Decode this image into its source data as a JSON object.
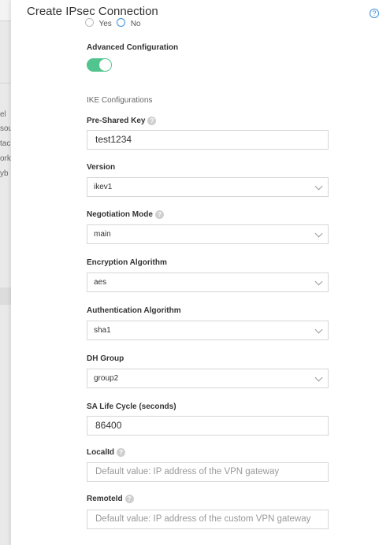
{
  "backdrop": {
    "lines": [
      "el",
      "sou",
      "tac",
      "ork",
      "yb"
    ]
  },
  "drawer": {
    "title": "Create IPsec Connection",
    "help_icon": "?"
  },
  "radio_group": {
    "options": [
      {
        "label": "Yes",
        "checked": false
      },
      {
        "label": "No",
        "checked": true
      }
    ]
  },
  "advanced": {
    "label": "Advanced Configuration",
    "enabled": true
  },
  "ike_section": "IKE Configurations",
  "fields": {
    "psk": {
      "label": "Pre-Shared Key",
      "value": "test1234"
    },
    "version": {
      "label": "Version",
      "value": "ikev1"
    },
    "negotiation": {
      "label": "Negotiation Mode",
      "value": "main"
    },
    "encryption": {
      "label": "Encryption Algorithm",
      "value": "aes"
    },
    "authentication": {
      "label": "Authentication Algorithm",
      "value": "sha1"
    },
    "dh_group": {
      "label": "DH Group",
      "value": "group2"
    },
    "sa_life": {
      "label": "SA Life Cycle (seconds)",
      "value": "86400"
    },
    "local_id": {
      "label": "LocalId",
      "placeholder": "Default value: IP address of the VPN gateway"
    },
    "remote_id": {
      "label": "RemoteId",
      "placeholder": "Default value: IP address of the custom VPN gateway"
    }
  },
  "icons": {
    "help": "help-circle-icon",
    "question": "question-icon",
    "chevron": "chevron-down-icon"
  },
  "colors": {
    "toggle_on": "#52c48e",
    "accent": "#3d8ede"
  }
}
